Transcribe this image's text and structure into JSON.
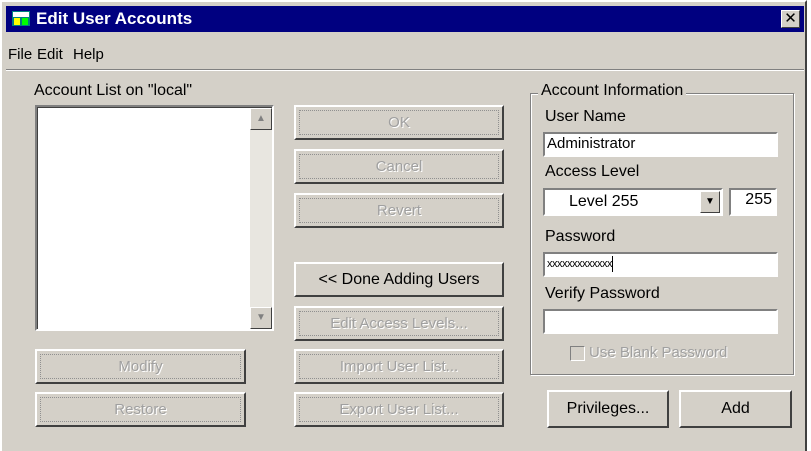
{
  "window": {
    "title": "Edit User Accounts",
    "close_glyph": "✕"
  },
  "menu": {
    "file": "File",
    "edit": "Edit",
    "help": "Help"
  },
  "accounts": {
    "list_label": "Account List on \"local\"",
    "items": []
  },
  "buttons": {
    "ok": "OK",
    "cancel": "Cancel",
    "revert": "Revert",
    "done_adding": "<< Done Adding Users",
    "edit_access": "Edit Access Levels...",
    "import": "Import User List...",
    "export": "Export User List...",
    "modify": "Modify",
    "restore": "Restore",
    "privileges": "Privileges...",
    "add": "Add"
  },
  "account_info": {
    "group_title": "Account Information",
    "user_name_label": "User Name",
    "user_name_value": "Administrator",
    "access_level_label": "Access Level",
    "access_level_value": "Level 255",
    "access_level_number": "255",
    "password_label": "Password",
    "password_value": "xxxxxxxxxxxxx",
    "verify_label": "Verify Password",
    "verify_value": "",
    "blank_password_label": "Use Blank Password"
  }
}
